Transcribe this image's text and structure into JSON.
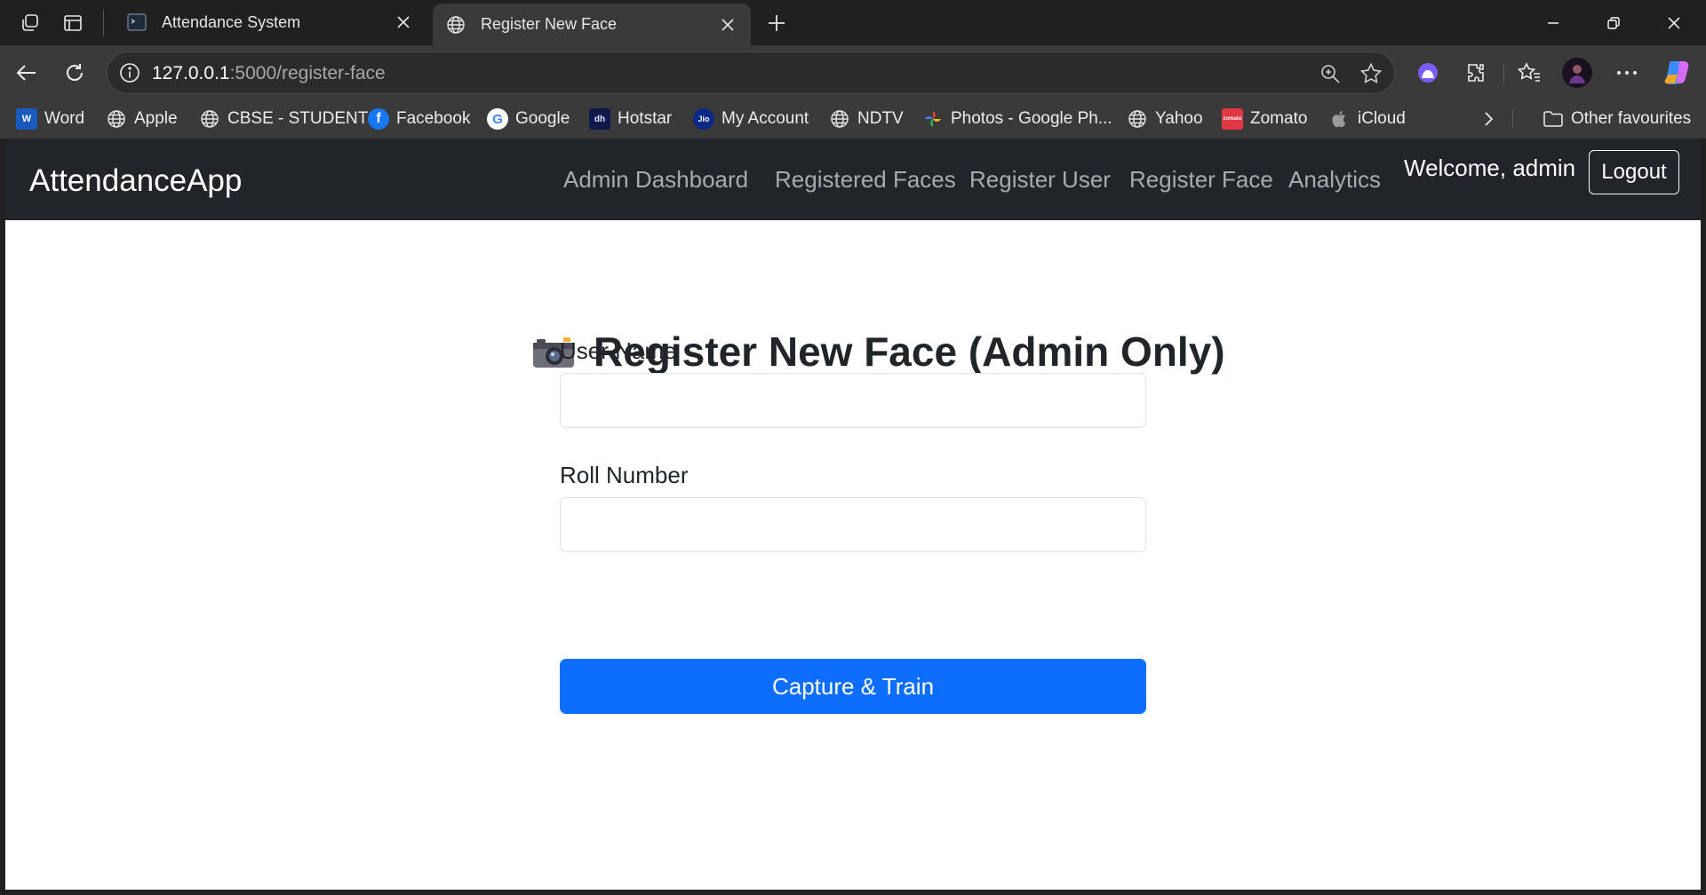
{
  "browser": {
    "tabs": [
      {
        "title": "Attendance System",
        "active": false
      },
      {
        "title": "Register New Face",
        "active": true
      }
    ],
    "url": {
      "host": "127.0.0.1",
      "path": ":5000/register-face"
    },
    "favourites": [
      {
        "label": "Word",
        "icon": "word-icon"
      },
      {
        "label": "Apple",
        "icon": "globe-icon"
      },
      {
        "label": "CBSE - STUDENT",
        "icon": "globe-icon"
      },
      {
        "label": "Facebook",
        "icon": "facebook-icon"
      },
      {
        "label": "Google",
        "icon": "google-icon"
      },
      {
        "label": "Hotstar",
        "icon": "hotstar-icon"
      },
      {
        "label": "My Account",
        "icon": "jio-icon"
      },
      {
        "label": "NDTV",
        "icon": "globe-icon"
      },
      {
        "label": "Photos - Google Ph...",
        "icon": "google-photos-icon"
      },
      {
        "label": "Yahoo",
        "icon": "globe-icon"
      },
      {
        "label": "Zomato",
        "icon": "zomato-icon"
      },
      {
        "label": "iCloud",
        "icon": "apple-icon"
      }
    ],
    "other_favourites": "Other favourites",
    "colors": {
      "chrome_dark": "#202020",
      "toolbar": "#3a3a3a"
    }
  },
  "app": {
    "brand": "AttendanceApp",
    "nav": [
      "Admin Dashboard",
      "Registered Faces",
      "Register User",
      "Register Face",
      "Analytics"
    ],
    "welcome": "Welcome, admin",
    "logout": "Logout",
    "colors": {
      "navbar": "#212529",
      "primary": "#0d6efd"
    }
  },
  "form": {
    "title": "Register New Face (Admin Only)",
    "title_icon": "camera-icon",
    "user_name_label": "User Name",
    "user_name_value": "",
    "roll_number_label": "Roll Number",
    "roll_number_value": "",
    "submit_label": "Capture & Train"
  }
}
